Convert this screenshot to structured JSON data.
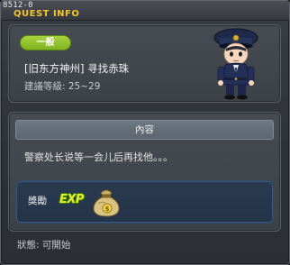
{
  "window": {
    "id_code": "8512-0",
    "title": "QUEST INFO"
  },
  "quest": {
    "category_badge": "一般",
    "name": "[旧东方神州] 寻找赤珠",
    "level_range": "建議等級: 25~29"
  },
  "content": {
    "header": "內容",
    "description": "警察处长说等一会儿后再找他。。。"
  },
  "reward": {
    "label": "獎勵",
    "exp_label": "EXP",
    "icons": [
      "exp-icon",
      "money-bag-icon"
    ]
  },
  "status": {
    "text": "狀態:  可開始"
  },
  "colors": {
    "title": "#f3c52a",
    "badge": "#8ec22c",
    "reward_panel": "#263650"
  }
}
